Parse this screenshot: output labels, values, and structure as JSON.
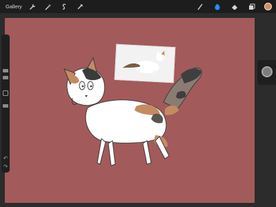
{
  "topbar": {
    "gallery_label": "Gallery",
    "left_tools": [
      "wrench-icon",
      "magic-wand-icon",
      "selection-s-icon",
      "transform-arrow-icon"
    ],
    "right_tools": [
      "brush-icon",
      "smudge-icon",
      "eraser-icon",
      "layers-icon"
    ],
    "current_color": "#d98b5a"
  },
  "canvas": {
    "background_color": "#a35a5a"
  },
  "sidebar": {
    "undo_icon": "↶",
    "redo_icon": "↷"
  }
}
